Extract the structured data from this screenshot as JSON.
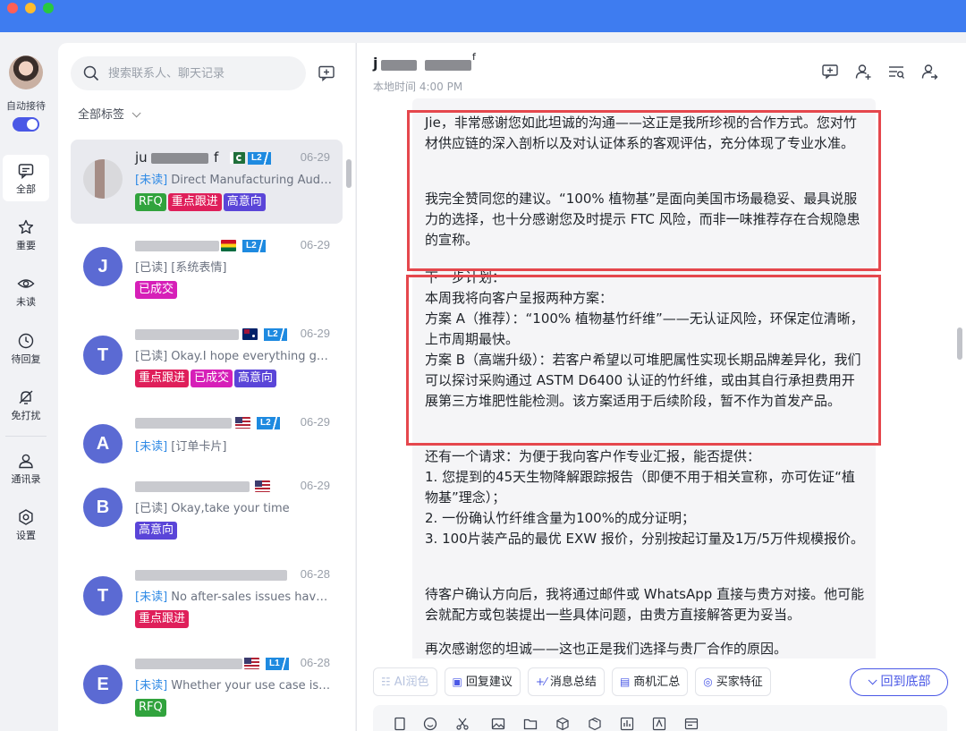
{
  "window": {
    "traffic_lights": [
      "#ff5f57",
      "#febc2e",
      "#28c840"
    ],
    "titlebar_color": "#3e7cf0"
  },
  "rail": {
    "auto_reception_label": "自动接待",
    "auto_reception_on": true,
    "items": [
      {
        "label": "全部",
        "icon": "chat-icon",
        "active": true
      },
      {
        "label": "重要",
        "icon": "star-icon"
      },
      {
        "label": "未读",
        "icon": "eye-icon"
      },
      {
        "label": "待回复",
        "icon": "clock-icon"
      },
      {
        "label": "免打扰",
        "icon": "bell-off-icon"
      },
      {
        "label": "通讯录",
        "icon": "contacts-icon"
      },
      {
        "label": "设置",
        "icon": "settings-icon"
      }
    ]
  },
  "search": {
    "placeholder": "搜索联系人、聊天记录"
  },
  "tag_filter": {
    "label": "全部标签"
  },
  "tag_colors": {
    "RFQ": "#31a33d",
    "重点跟进": "#df1f5a",
    "高意向": "#5a45d8",
    "已成交": "#d61fb8"
  },
  "chats": [
    {
      "avatar": "",
      "name_visible": "ju",
      "name_suffix": "f",
      "flag": "PK",
      "level": "L2",
      "time": "06-29",
      "status": "[未读]",
      "preview": "Direct Manufacturing Audit...",
      "tags": [
        "RFQ",
        "重点跟进",
        "高意向"
      ]
    },
    {
      "avatar": "J",
      "flag": "GH",
      "level": "L2",
      "time": "06-29",
      "status": "[已读]",
      "preview": "[系统表情]",
      "tags": [
        "已成交"
      ]
    },
    {
      "avatar": "T",
      "flag": "AU",
      "level": "L2",
      "time": "06-29",
      "status": "[已读]",
      "preview": "Okay.I hope everything goes well",
      "tags": [
        "重点跟进",
        "已成交",
        "高意向"
      ]
    },
    {
      "avatar": "A",
      "flag": "US",
      "level": "L2",
      "time": "06-29",
      "status": "[未读]",
      "preview": "[订单卡片]",
      "tags": []
    },
    {
      "avatar": "B",
      "flag": "US",
      "time": "06-29",
      "status": "[已读]",
      "preview": "Okay,take your time",
      "tags": [
        "高意向"
      ]
    },
    {
      "avatar": "T",
      "time": "06-28",
      "status": "[未读]",
      "preview": "No after-sales issues have been...",
      "tags": [
        "重点跟进"
      ]
    },
    {
      "avatar": "E",
      "flag": "US",
      "level": "L1",
      "time": "06-28",
      "status": "[未读]",
      "preview": "Whether your use case is for...",
      "tags": [
        "RFQ"
      ]
    }
  ],
  "conversation": {
    "name_visible": "j",
    "name_suffix": "f",
    "local_time": "本地时间 4:00 PM",
    "header_icons": [
      "add-chat-icon",
      "add-user-icon",
      "filter-list-icon",
      "transfer-user-icon"
    ],
    "paragraphs": [
      "Jie，非常感谢您如此坦诚的沟通——这正是我所珍视的合作方式。您对竹材供应链的深入剖析以及对认证体系的客观评估，充分体现了专业水准。",
      "我完全赞同您的建议。“100% 植物基”是面向美国市场最稳妥、最具说服力的选择，也十分感谢您及时提示 FTC 风险，而非一味推荐存在合规隐患的宣称。",
      "下一步计划：\n本周我将向客户呈报两种方案：\n方案 A（推荐）：“100% 植物基竹纤维”——无认证风险，环保定位清晰，上市周期最快。\n方案 B（高端升级）：若客户希望以可堆肥属性实现长期品牌差异化，我们可以探讨采购通过 ASTM D6400 认证的竹纤维，或由其自行承担费用开展第三方堆肥性能检测。该方案适用于后续阶段，暂不作为首发产品。",
      "还有一个请求：为便于我向客户作专业汇报，能否提供：\n1. 您提到的45天生物降解跟踪报告（即便不用于相关宣称，亦可佐证“植物基”理念）；\n2. 一份确认竹纤维含量为100%的成分证明；\n3. 100片装产品的最优 EXW 报价，分别按起订量及1万/5万件规模报价。",
      "待客户确认方向后，我将通过邮件或 WhatsApp 直接与贵方对接。他可能会就配方或包装提出一些具体问题，由贵方直接解答更为妥当。",
      "再次感谢您的坦诚——这也正是我们选择与贵厂合作的原因。"
    ]
  },
  "toolbar": {
    "buttons": [
      {
        "label": "AI润色",
        "icon": "polish-icon",
        "disabled": true
      },
      {
        "label": "回复建议",
        "icon": "reply-suggest-icon"
      },
      {
        "label": "消息总结",
        "icon": "summary-icon"
      },
      {
        "label": "商机汇总",
        "icon": "opportunity-icon"
      },
      {
        "label": "买家特征",
        "icon": "buyer-profile-icon"
      }
    ],
    "back_to_bottom": "回到底部"
  },
  "composer_icons": [
    "file-icon",
    "emoji-icon",
    "scissors-icon",
    "image-icon",
    "folder-icon",
    "product-icon",
    "package-icon",
    "chart-icon",
    "card-icon",
    "invoice-icon"
  ],
  "accent": "#4a58e6",
  "highlight_color": "#e5474d"
}
